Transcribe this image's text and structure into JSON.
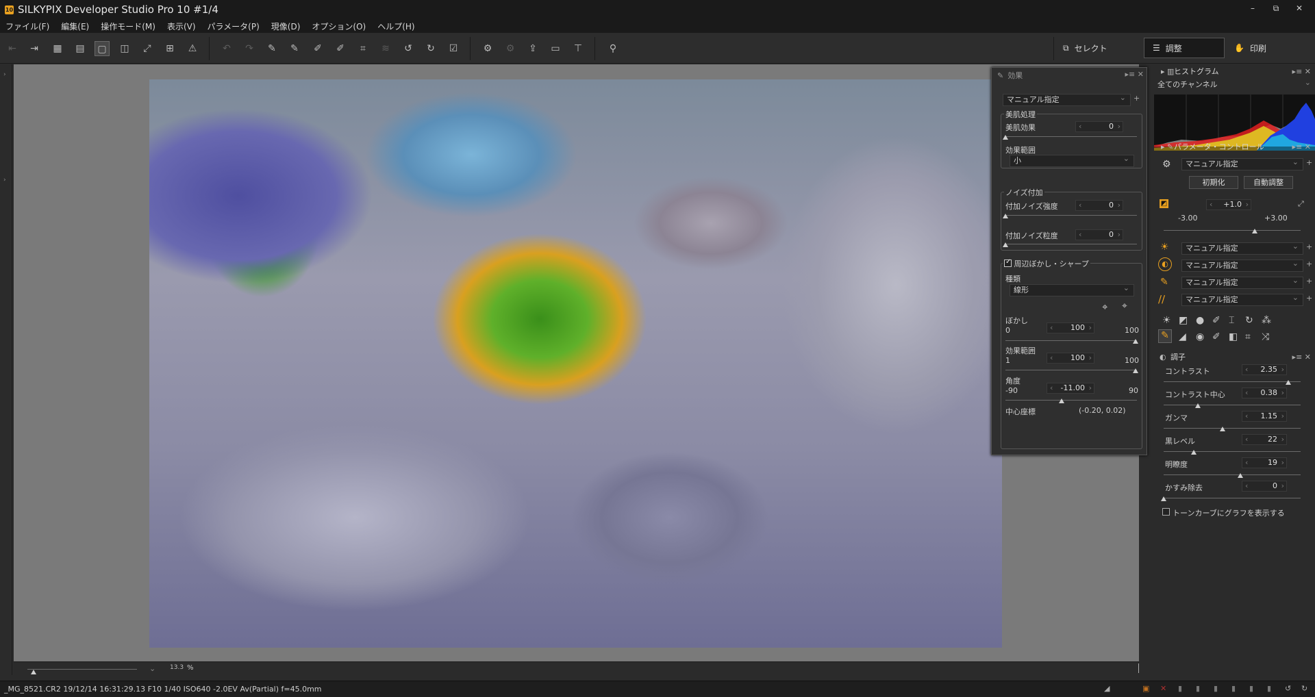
{
  "app": {
    "title": "SILKYPIX Developer Studio Pro 10   #1/4",
    "logo": "10"
  },
  "window_controls": {
    "minimize": "–",
    "restore": "⧉",
    "close": "✕"
  },
  "menu": [
    "ファイル(F)",
    "編集(E)",
    "操作モード(M)",
    "表示(V)",
    "パラメータ(P)",
    "現像(D)",
    "オプション(O)",
    "ヘルプ(H)"
  ],
  "modes": {
    "select": "セレクト",
    "adjust": "調整",
    "print": "印刷"
  },
  "zoom": {
    "value": "13.3",
    "unit": "%"
  },
  "status": {
    "info": "_MG_8521.CR2 19/12/14 16:31:29.13 F10 1/40 ISO640 -2.0EV Av(Partial) f=45.0mm"
  },
  "effect_panel": {
    "title": "効果",
    "preset": "マニュアル指定",
    "skin": {
      "group": "美肌処理",
      "effect_label": "美肌効果",
      "effect_value": "0",
      "range_label": "効果範囲",
      "range_value": "小"
    },
    "noise": {
      "group": "ノイズ付加",
      "strength_label": "付加ノイズ強度",
      "strength_value": "0",
      "grain_label": "付加ノイズ粒度",
      "grain_value": "0"
    },
    "blur": {
      "group": "周辺ぼかし・シャープ",
      "checked": true,
      "type_label": "種類",
      "type_value": "線形",
      "blur_label": "ぼかし",
      "blur_min": "0",
      "blur_value": "100",
      "blur_max": "100",
      "range_label": "効果範囲",
      "range_min": "1",
      "range_value": "100",
      "range_max": "100",
      "angle_label": "角度",
      "angle_min": "-90",
      "angle_value": "-11.00",
      "angle_max": "90",
      "center_label": "中心座標",
      "center_value": "(-0.20, 0.02)"
    }
  },
  "histogram": {
    "title": "ヒストグラム",
    "channel": "全てのチャンネル"
  },
  "param_control": {
    "title": "パラメータ・コントロール",
    "preset": "マニュアル指定",
    "reset": "初期化",
    "auto": "自動調整",
    "exposure": {
      "value": "+1.0",
      "min": "-3.00",
      "max": "+3.00",
      "level": 0.667
    },
    "rows": [
      "マニュアル指定",
      "マニュアル指定",
      "マニュアル指定",
      "マニュアル指定"
    ]
  },
  "tone": {
    "title": "調子",
    "rows": [
      {
        "label": "コントラスト",
        "value": "2.35"
      },
      {
        "label": "コントラスト中心",
        "value": "0.38"
      },
      {
        "label": "ガンマ",
        "value": "1.15"
      },
      {
        "label": "黒レベル",
        "value": "22"
      },
      {
        "label": "明瞭度",
        "value": "19"
      },
      {
        "label": "かすみ除去",
        "value": "0"
      }
    ],
    "curve_checkbox": "トーンカーブにグラフを表示する"
  },
  "colors": {
    "accent": "#e8a020",
    "panel": "#2b2b2b",
    "titlebar": "#1a1a1a"
  }
}
